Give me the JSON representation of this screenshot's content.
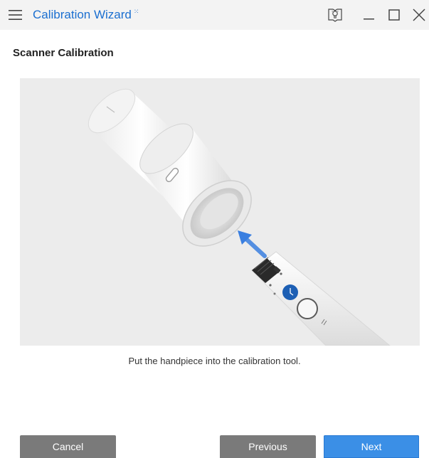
{
  "window": {
    "title": "Calibration Wizard",
    "title_badge": "⁙"
  },
  "titlebar_icons": {
    "menu": "menu-icon",
    "help": "help-manual-icon",
    "minimize": "minimize-icon",
    "maximize": "maximize-icon",
    "close": "close-icon"
  },
  "page": {
    "heading": "Scanner Calibration",
    "instruction": "Put the handpiece into the calibration tool."
  },
  "illustration": {
    "subject": "handpiece-into-calibration-tool",
    "arrow_color": "#3a7fe0",
    "handpiece_button_color": "#1d5fb4"
  },
  "buttons": {
    "cancel": "Cancel",
    "previous": "Previous",
    "next": "Next"
  },
  "colors": {
    "accent": "#1b6fd0",
    "primary_button": "#3b8fe6",
    "secondary_button": "#7a7a7a",
    "illustration_bg": "#ececec"
  }
}
